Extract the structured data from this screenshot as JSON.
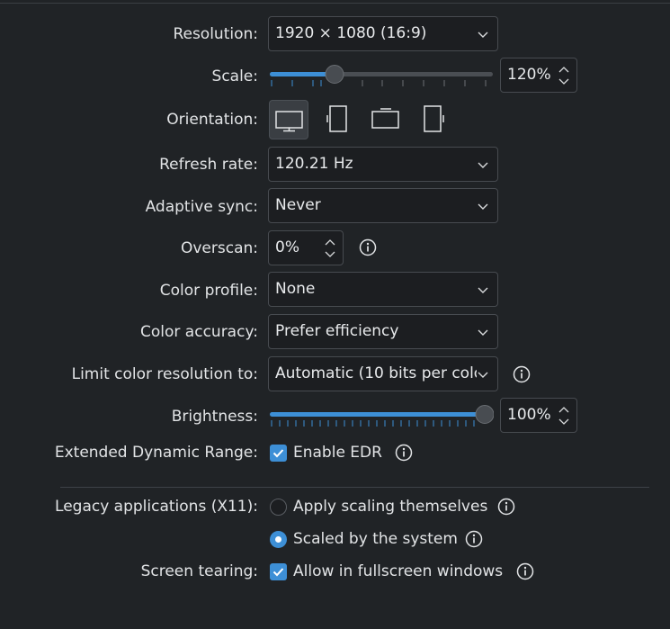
{
  "resolution": {
    "label": "Resolution:",
    "value": "1920 × 1080 (16:9)"
  },
  "scale": {
    "label": "Scale:",
    "value": "120%",
    "level": 0.25
  },
  "orientation": {
    "label": "Orientation:",
    "options": [
      "landscape",
      "portrait-left",
      "landscape-flipped",
      "portrait-right"
    ],
    "selected": "landscape"
  },
  "refresh_rate": {
    "label": "Refresh rate:",
    "value": "120.21 Hz"
  },
  "adaptive_sync": {
    "label": "Adaptive sync:",
    "value": "Never"
  },
  "overscan": {
    "label": "Overscan:",
    "value": "0%"
  },
  "color_profile": {
    "label": "Color profile:",
    "value": "None"
  },
  "color_accuracy": {
    "label": "Color accuracy:",
    "value": "Prefer efficiency"
  },
  "limit_color": {
    "label": "Limit color resolution to:",
    "value": "Automatic  (10 bits per colo"
  },
  "brightness": {
    "label": "Brightness:",
    "value": "100%",
    "level": 1.0
  },
  "edr": {
    "label": "Extended Dynamic Range:",
    "option": "Enable EDR",
    "checked": true
  },
  "legacy": {
    "label": "Legacy applications (X11):",
    "option_a": "Apply scaling themselves",
    "option_b": "Scaled by the system",
    "selected": "option_b"
  },
  "tearing": {
    "label": "Screen tearing:",
    "option": "Allow in fullscreen windows",
    "checked": true
  },
  "colors": {
    "accent": "#3d8fd6",
    "background": "#202326",
    "field": "#1c1e21"
  },
  "icons": {
    "dropdown": "chevron-down-icon",
    "spin": "spin-arrows-icon",
    "info": "info-icon"
  }
}
